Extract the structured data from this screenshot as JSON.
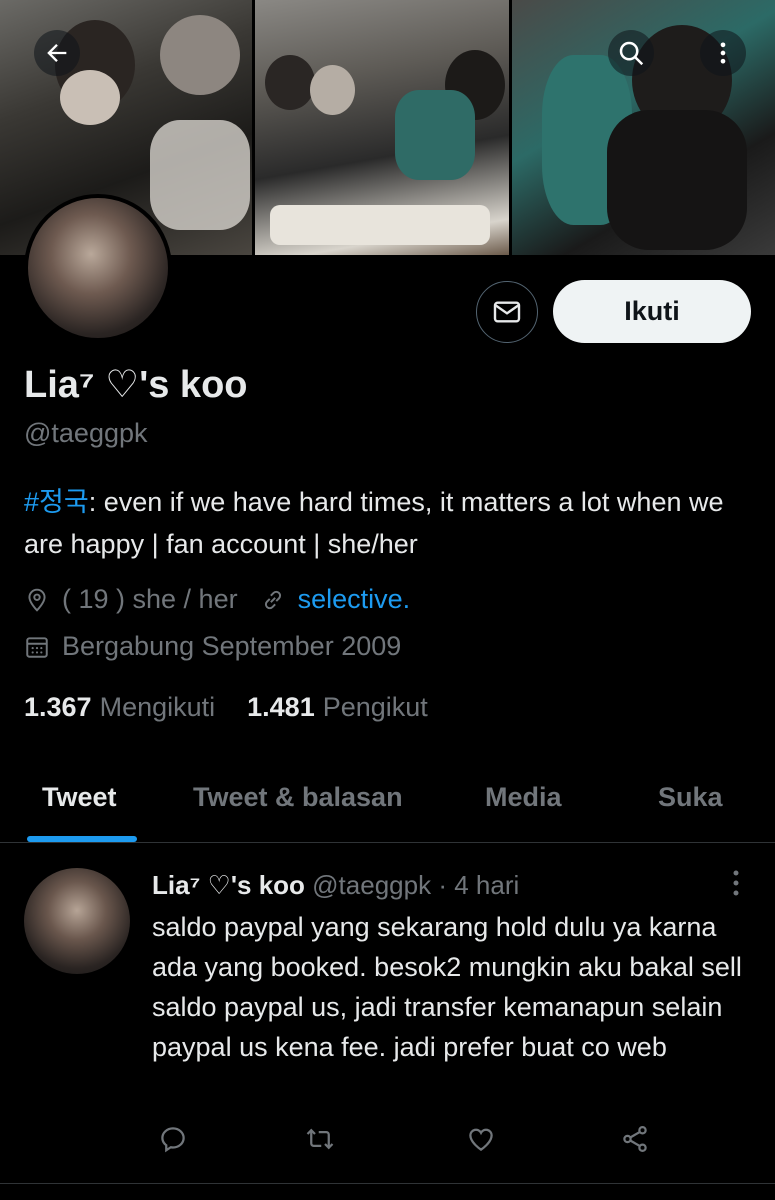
{
  "profile": {
    "name": "Lia⁷ ♡'s koo",
    "handle": "@taeggpk",
    "bio_tag": "#정국",
    "bio_text": ": even if we have hard times, it matters a lot when we are happy | fan account | she/her",
    "location": "( 19 ) she / her",
    "website": "selective.",
    "joined": "Bergabung September 2009",
    "following_count": "1.367",
    "following_label": "Mengikuti",
    "followers_count": "1.481",
    "followers_label": "Pengikut"
  },
  "buttons": {
    "follow_label": "Ikuti"
  },
  "icons": {
    "back": "arrow-left-icon",
    "search": "search-icon",
    "more": "more-vertical-icon",
    "message": "envelope-icon",
    "location": "location-pin-icon",
    "link": "link-icon",
    "calendar": "calendar-icon",
    "reply": "reply-icon",
    "retweet": "retweet-icon",
    "like": "heart-icon",
    "share": "share-icon"
  },
  "tabs": [
    {
      "label": "Tweet"
    },
    {
      "label": "Tweet & balasan"
    },
    {
      "label": "Media"
    },
    {
      "label": "Suka"
    }
  ],
  "active_tab": "Tweet",
  "tweet": {
    "name": "Lia⁷ ♡'s koo",
    "handle": "@taeggpk",
    "separator": "·",
    "time": "4 hari",
    "text": "saldo paypal yang sekarang hold dulu ya karna ada yang booked. besok2 mungkin aku bakal sell saldo paypal us, jadi transfer kemanapun selain paypal us kena fee. jadi prefer buat co web"
  },
  "colors": {
    "background": "#000000",
    "accent": "#1d9bf0",
    "text_primary": "#e7e9ea",
    "text_secondary": "#71767b",
    "follow_button_bg": "#eff3f4"
  }
}
